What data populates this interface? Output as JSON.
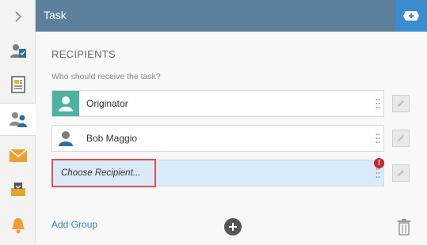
{
  "header": {
    "title": "Task"
  },
  "recipients": {
    "title": "RECIPIENTS",
    "subtitle": "Who should receive the task?",
    "items": [
      {
        "label": "Originator",
        "avatar": "user-teal-icon"
      },
      {
        "label": "Bob Maggio",
        "avatar": "user-icon"
      }
    ],
    "choose_label": "Choose Recipient...",
    "alert_symbol": "!"
  },
  "footer": {
    "add_group_label": "Add Group"
  },
  "colors": {
    "header_bg": "#5c7f9b",
    "header_add_bg": "#3a8ed0",
    "accent_link": "#2f86c8",
    "highlight_border": "#e05050",
    "error": "#c6262e",
    "originator_avatar": "#4bb3a4"
  },
  "rail": [
    "chevron-right-icon",
    "user-check-icon",
    "document-icon",
    "users-icon",
    "mail-icon",
    "inbox-icon",
    "bell-icon"
  ]
}
